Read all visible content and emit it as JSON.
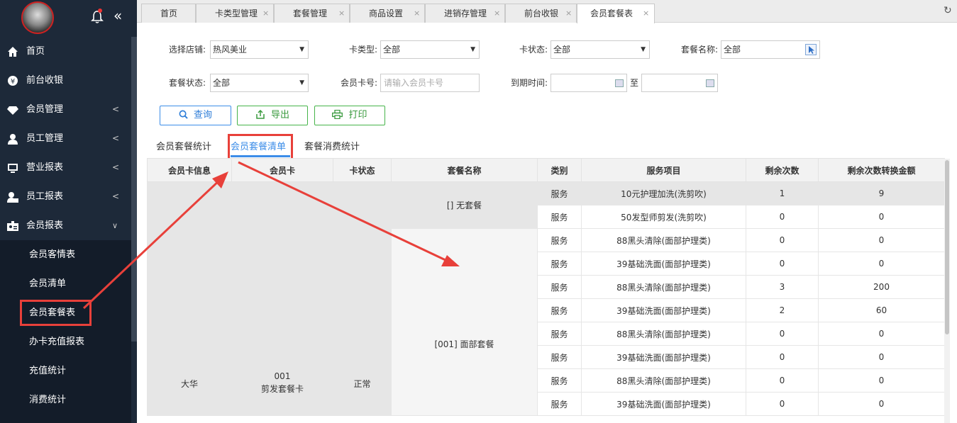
{
  "sidebar": {
    "items": [
      {
        "label": "首页",
        "icon": "home-icon",
        "has_children": false
      },
      {
        "label": "前台收银",
        "icon": "yen-coin-icon",
        "has_children": false
      },
      {
        "label": "会员管理",
        "icon": "diamond-icon",
        "has_children": true
      },
      {
        "label": "员工管理",
        "icon": "user-icon",
        "has_children": true
      },
      {
        "label": "营业报表",
        "icon": "monitor-icon",
        "has_children": true
      },
      {
        "label": "员工报表",
        "icon": "user-report-icon",
        "has_children": true
      },
      {
        "label": "会员报表",
        "icon": "id-card-icon",
        "has_children": true,
        "expanded": true
      }
    ],
    "subitems": [
      "会员客情表",
      "会员清单",
      "会员套餐表",
      "办卡充值报表",
      "充值统计",
      "消费统计"
    ],
    "active_subitem": "会员套餐表"
  },
  "tabs": [
    {
      "label": "首页",
      "closable": false
    },
    {
      "label": "卡类型管理",
      "closable": true
    },
    {
      "label": "套餐管理",
      "closable": true
    },
    {
      "label": "商品设置",
      "closable": true
    },
    {
      "label": "进销存管理",
      "closable": true
    },
    {
      "label": "前台收银",
      "closable": true
    },
    {
      "label": "会员套餐表",
      "closable": true,
      "active": true
    }
  ],
  "tab_close": "×",
  "filters": {
    "store_label": "选择店铺:",
    "store_value": "热风美业",
    "card_type_label": "卡类型:",
    "card_type_value": "全部",
    "card_status_label": "卡状态:",
    "card_status_value": "全部",
    "package_name_label": "套餐名称:",
    "package_name_value": "全部",
    "package_status_label": "套餐状态:",
    "package_status_value": "全部",
    "card_no_label": "会员卡号:",
    "card_no_placeholder": "请输入会员卡号",
    "expire_label": "到期时间:",
    "to": "至"
  },
  "buttons": {
    "query": "查询",
    "export": "导出",
    "print": "打印"
  },
  "subtabs": [
    "会员套餐统计",
    "会员套餐清单",
    "套餐消费统计"
  ],
  "active_subtab": "会员套餐清单",
  "table": {
    "headers": [
      "会员卡信息",
      "会员卡",
      "卡状态",
      "套餐名称",
      "类别",
      "服务项目",
      "剩余次数",
      "剩余次数转换金额"
    ],
    "member": "大华",
    "card_no": "001",
    "card_name": "剪发套餐卡",
    "card_status": "正常",
    "packages": [
      "[] 无套餐",
      "[001] 面部套餐"
    ],
    "rows": [
      {
        "type": "服务",
        "item": "10元护理加洗(洗剪吹)",
        "remain": "1",
        "amount": "9"
      },
      {
        "type": "服务",
        "item": "50发型师剪发(洗剪吹)",
        "remain": "0",
        "amount": "0"
      },
      {
        "type": "服务",
        "item": "88黑头清除(面部护理类)",
        "remain": "0",
        "amount": "0"
      },
      {
        "type": "服务",
        "item": "39基础洗面(面部护理类)",
        "remain": "0",
        "amount": "0"
      },
      {
        "type": "服务",
        "item": "88黑头清除(面部护理类)",
        "remain": "3",
        "amount": "200"
      },
      {
        "type": "服务",
        "item": "39基础洗面(面部护理类)",
        "remain": "2",
        "amount": "60"
      },
      {
        "type": "服务",
        "item": "88黑头清除(面部护理类)",
        "remain": "0",
        "amount": "0"
      },
      {
        "type": "服务",
        "item": "39基础洗面(面部护理类)",
        "remain": "0",
        "amount": "0"
      },
      {
        "type": "服务",
        "item": "88黑头清除(面部护理类)",
        "remain": "0",
        "amount": "0"
      },
      {
        "type": "服务",
        "item": "39基础洗面(面部护理类)",
        "remain": "0",
        "amount": "0"
      }
    ]
  },
  "colors": {
    "sidebar_bg": "#1d2939",
    "accent": "#3c8de8",
    "annotation_red": "#e8403a",
    "green": "#46b44a"
  }
}
